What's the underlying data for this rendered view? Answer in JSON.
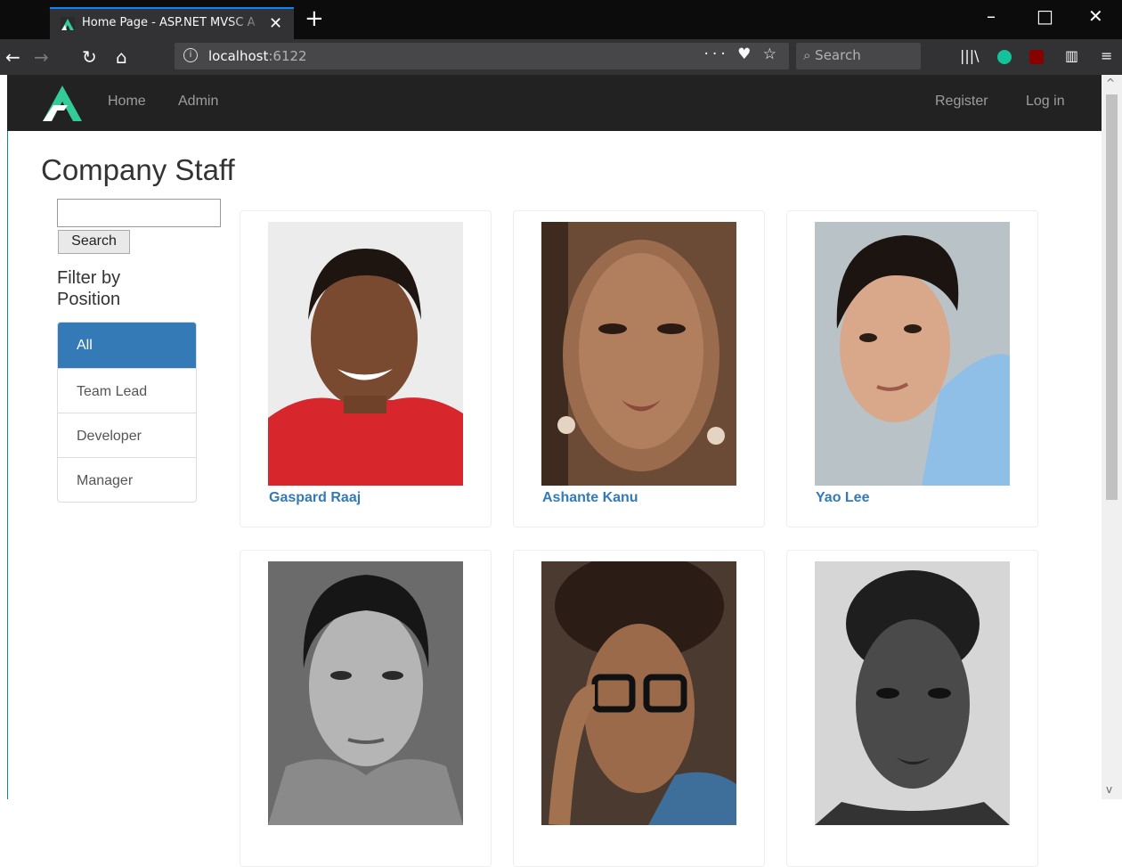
{
  "browser": {
    "tab_title": "Home Page - ASP.NET MVSC A",
    "url_host": "localhost",
    "url_port": ":6122",
    "search_placeholder": "Search",
    "page_actions": "··· ♥ ☆"
  },
  "site": {
    "nav": {
      "home": "Home",
      "admin": "Admin",
      "register": "Register",
      "login": "Log in"
    },
    "title": "Company Staff",
    "search": {
      "value": "",
      "button": "Search"
    },
    "filter": {
      "title": "Filter by Position",
      "items": [
        {
          "label": "All",
          "active": true
        },
        {
          "label": "Team Lead",
          "active": false
        },
        {
          "label": "Developer",
          "active": false
        },
        {
          "label": "Manager",
          "active": false
        }
      ]
    },
    "staff": [
      {
        "name": "Gaspard Raaj"
      },
      {
        "name": "Ashante Kanu"
      },
      {
        "name": "Yao Lee"
      },
      {
        "name": ""
      },
      {
        "name": ""
      },
      {
        "name": ""
      }
    ]
  }
}
